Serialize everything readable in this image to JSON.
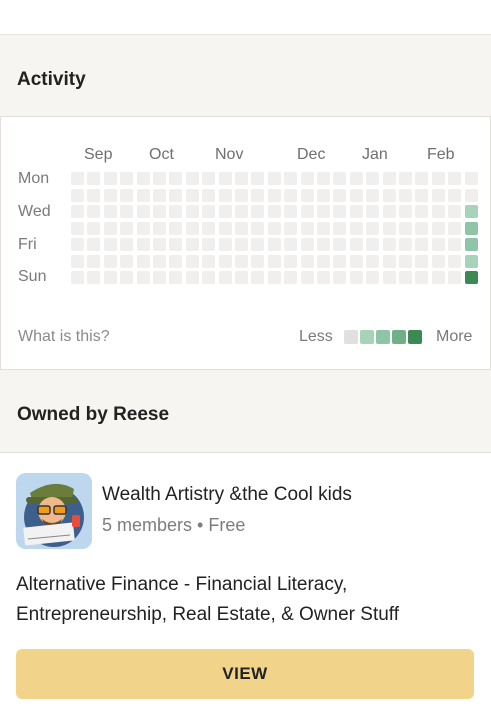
{
  "activity": {
    "title": "Activity",
    "months": [
      "Sep",
      "Oct",
      "Nov",
      "Dec",
      "Jan",
      "Feb"
    ],
    "days": [
      "Mon",
      "Wed",
      "Fri",
      "Sun"
    ],
    "weeks": 25,
    "rows": 7,
    "levels": [
      {
        "week": 24,
        "day": 2,
        "level": 1
      },
      {
        "week": 24,
        "day": 3,
        "level": 2
      },
      {
        "week": 24,
        "day": 4,
        "level": 2
      },
      {
        "week": 24,
        "day": 5,
        "level": 1
      },
      {
        "week": 24,
        "day": 6,
        "level": 4
      }
    ],
    "what_is_this": "What is this?",
    "legend_less": "Less",
    "legend_more": "More",
    "level_colors": [
      "#f0efed",
      "#e0e0de",
      "#a7d3bb",
      "#8ec5a7",
      "#6fb089",
      "#3b8a54"
    ]
  },
  "owned": {
    "title": "Owned by Reese"
  },
  "group": {
    "name": "Wealth Artistry &the Cool kids",
    "meta": "5 members • Free",
    "description": "Alternative Finance - Financial Literacy, Entrepreneurship, Real Estate, & Owner Stuff",
    "view_label": "VIEW",
    "avatar_caption": "Wealth Artistry"
  }
}
